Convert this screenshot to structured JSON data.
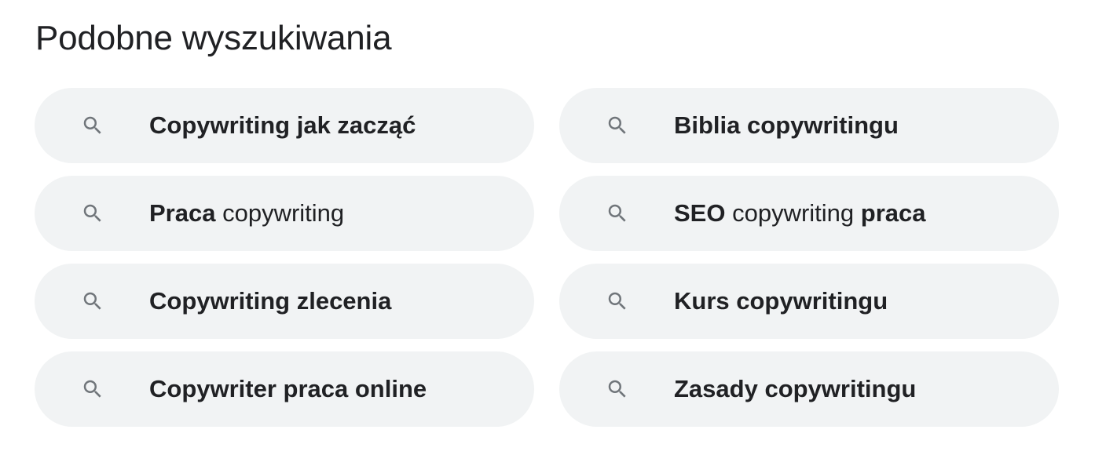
{
  "section": {
    "title": "Podobne wyszukiwania"
  },
  "colors": {
    "chip_background": "#f1f3f4",
    "text": "#202124",
    "icon": "#70757a"
  },
  "related_searches": [
    {
      "icon": "search-icon",
      "segments": [
        {
          "text": "Copywriting jak zacząć",
          "bold": true
        }
      ]
    },
    {
      "icon": "search-icon",
      "segments": [
        {
          "text": "Biblia copywritingu",
          "bold": true
        }
      ]
    },
    {
      "icon": "search-icon",
      "segments": [
        {
          "text": "Praca",
          "bold": true
        },
        {
          "text": " copywriting",
          "bold": false
        }
      ]
    },
    {
      "icon": "search-icon",
      "segments": [
        {
          "text": "SEO",
          "bold": true
        },
        {
          "text": " copywriting ",
          "bold": false
        },
        {
          "text": "praca",
          "bold": true
        }
      ]
    },
    {
      "icon": "search-icon",
      "segments": [
        {
          "text": "Copywriting zlecenia",
          "bold": true
        }
      ]
    },
    {
      "icon": "search-icon",
      "segments": [
        {
          "text": "Kurs copywritingu",
          "bold": true
        }
      ]
    },
    {
      "icon": "search-icon",
      "segments": [
        {
          "text": "Copywriter praca online",
          "bold": true
        }
      ]
    },
    {
      "icon": "search-icon",
      "segments": [
        {
          "text": "Zasady copywritingu",
          "bold": true
        }
      ]
    }
  ]
}
